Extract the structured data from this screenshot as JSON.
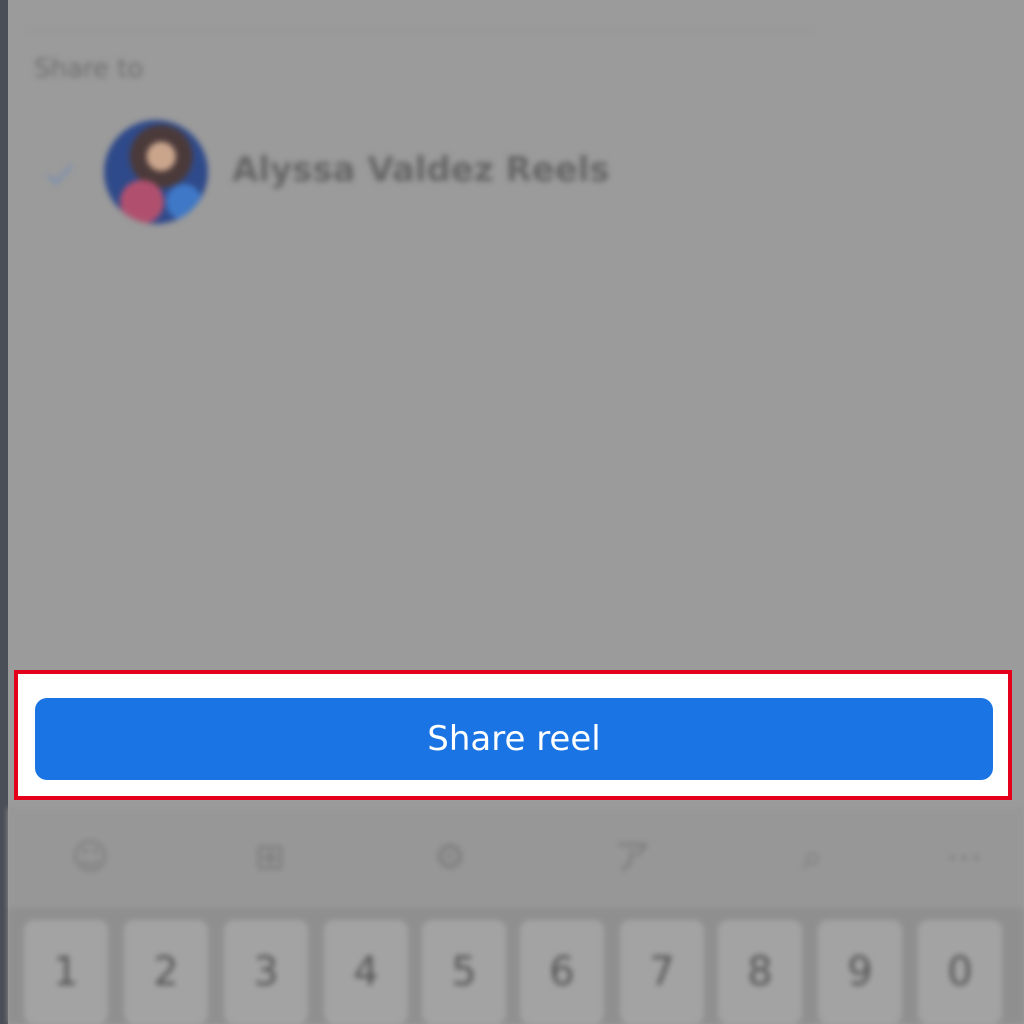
{
  "share_sheet": {
    "section_label": "Share to",
    "destination": {
      "name": "Alyssa Valdez Reels",
      "selected": true
    },
    "share_button_label": "Share reel"
  },
  "keyboard": {
    "toolbar_icons": [
      "emoji-icon",
      "gif-icon",
      "settings-icon",
      "translate-icon",
      "search-icon",
      "more-icon"
    ],
    "number_keys": [
      "1",
      "2",
      "3",
      "4",
      "5",
      "6",
      "7",
      "8",
      "9",
      "0"
    ]
  },
  "colors": {
    "accent": "#1a74e4",
    "highlight_border": "#e4001b",
    "overlay": "#9b9b9b"
  }
}
